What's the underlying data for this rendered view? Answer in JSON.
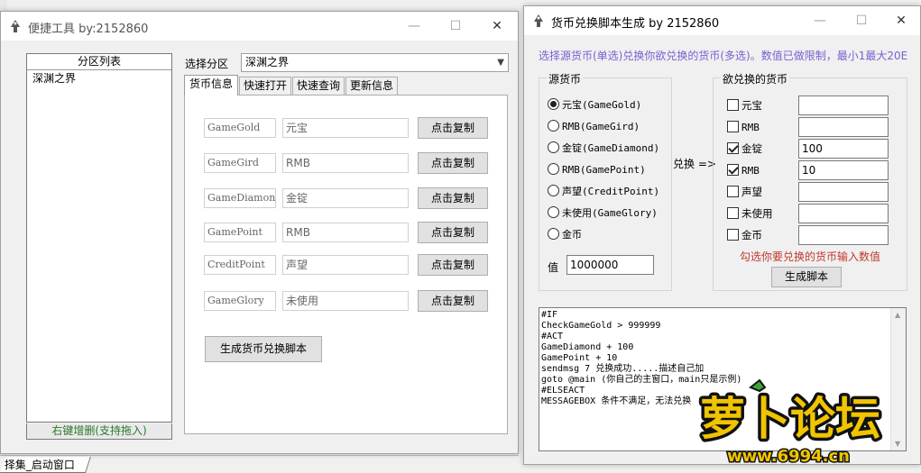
{
  "background": {
    "bottom_tab": "择集_启动窗口"
  },
  "window1": {
    "title": "便捷工具   by:2152860",
    "controls": {
      "minimize": "—",
      "maximize": "☐",
      "close": "✕"
    },
    "partition_list": {
      "header": "分区列表",
      "items": [
        "深渊之界"
      ],
      "footer": "右键增删(支持拖入)"
    },
    "select_partition": {
      "label": "选择分区",
      "value": "深渊之界"
    },
    "tabs": [
      {
        "label": "货币信息",
        "active": true
      },
      {
        "label": "快速打开",
        "active": false
      },
      {
        "label": "快速查询",
        "active": false
      },
      {
        "label": "更新信息",
        "active": false
      }
    ],
    "currency_rows": [
      {
        "name": "GameGold",
        "value": "元宝",
        "button": "点击复制"
      },
      {
        "name": "GameGird",
        "value": "RMB",
        "button": "点击复制"
      },
      {
        "name": "GameDiamond",
        "value": "金锭",
        "button": "点击复制"
      },
      {
        "name": "GamePoint",
        "value": "RMB",
        "button": "点击复制"
      },
      {
        "name": "CreditPoint",
        "value": "声望",
        "button": "点击复制"
      },
      {
        "name": "GameGlory",
        "value": "未使用",
        "button": "点击复制"
      }
    ],
    "generate_button": "生成货币兑换脚本"
  },
  "window2": {
    "title": "货币兑换脚本生成  by 2152860",
    "controls": {
      "minimize": "—",
      "maximize": "☐",
      "close": "✕"
    },
    "hint": "选择源货币(单选)兑换你欲兑换的货币(多选)。数值已做限制，最小1最大20E",
    "source_group": {
      "title": "源货币",
      "options": [
        {
          "label": "元宝(GameGold)",
          "selected": true
        },
        {
          "label": "RMB(GameGird)",
          "selected": false
        },
        {
          "label": "金锭(GameDiamond)",
          "selected": false
        },
        {
          "label": "RMB(GamePoint)",
          "selected": false
        },
        {
          "label": "声望(CreditPoint)",
          "selected": false
        },
        {
          "label": "未使用(GameGlory)",
          "selected": false
        },
        {
          "label": "金币",
          "selected": false
        }
      ],
      "value_label": "值",
      "value": "1000000"
    },
    "exchange_label": "兑换 =>",
    "target_group": {
      "title": "欲兑换的货币",
      "options": [
        {
          "label": "元宝",
          "checked": false,
          "value": ""
        },
        {
          "label": "RMB",
          "checked": false,
          "value": ""
        },
        {
          "label": "金锭",
          "checked": true,
          "value": "100"
        },
        {
          "label": "RMB",
          "checked": true,
          "value": "10"
        },
        {
          "label": "声望",
          "checked": false,
          "value": ""
        },
        {
          "label": "未使用",
          "checked": false,
          "value": ""
        },
        {
          "label": "金币",
          "checked": false,
          "value": ""
        }
      ],
      "hint": "勾选你要兑换的货币输入数值",
      "generate_button": "生成脚本"
    },
    "script_lines": [
      "#IF",
      "CheckGameGold > 999999",
      "#ACT",
      "GameDiamond + 100",
      "GamePoint + 10",
      "sendmsg 7 兑换成功.....描述自己加",
      "goto @main (你自己的主窗口，main只是示例)",
      "#ELSEACT",
      "MESSAGEBOX 条件不满足，无法兑换"
    ]
  },
  "watermark": {
    "brand": "萝卜论坛",
    "url": "www.6994.cn"
  }
}
